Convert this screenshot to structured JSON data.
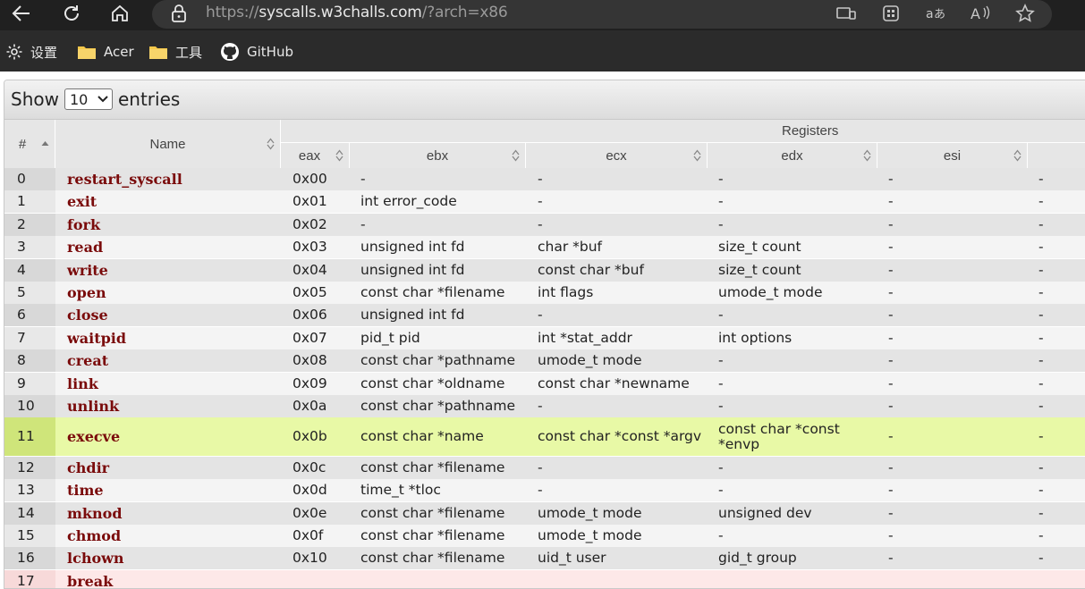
{
  "browser": {
    "url_prefix": "https://",
    "url_host": "syscalls.w3challs.com",
    "url_path": "/?arch=x86",
    "bookmarks": [
      {
        "label": "设置",
        "icon": "gear-icon"
      },
      {
        "label": "Acer",
        "icon": "folder-icon"
      },
      {
        "label": "工具",
        "icon": "folder-icon"
      },
      {
        "label": "GitHub",
        "icon": "github-icon"
      }
    ]
  },
  "table_controls": {
    "show_label": "Show",
    "entries_value": "10",
    "entries_label": "entries"
  },
  "columns": {
    "num": "#",
    "name": "Name",
    "registers": "Registers",
    "eax": "eax",
    "ebx": "ebx",
    "ecx": "ecx",
    "edx": "edx",
    "esi": "esi"
  },
  "colors": {
    "odd_row": "#e4e4e4",
    "even_row": "#f4f4f4",
    "highlight_row": "#e8f9a6",
    "highlight_num": "#cfe57a",
    "name_color": "#7a0b0b",
    "partial_row": "#fde8e8"
  },
  "rows": [
    {
      "num": "0",
      "name": "restart_syscall",
      "eax": "0x00",
      "ebx": "-",
      "ecx": "-",
      "edx": "-",
      "esi": "-",
      "edi": "-"
    },
    {
      "num": "1",
      "name": "exit",
      "eax": "0x01",
      "ebx": "int error_code",
      "ecx": "-",
      "edx": "-",
      "esi": "-",
      "edi": "-"
    },
    {
      "num": "2",
      "name": "fork",
      "eax": "0x02",
      "ebx": "-",
      "ecx": "-",
      "edx": "-",
      "esi": "-",
      "edi": "-"
    },
    {
      "num": "3",
      "name": "read",
      "eax": "0x03",
      "ebx": "unsigned int fd",
      "ecx": "char *buf",
      "edx": "size_t count",
      "esi": "-",
      "edi": "-"
    },
    {
      "num": "4",
      "name": "write",
      "eax": "0x04",
      "ebx": "unsigned int fd",
      "ecx": "const char *buf",
      "edx": "size_t count",
      "esi": "-",
      "edi": "-"
    },
    {
      "num": "5",
      "name": "open",
      "eax": "0x05",
      "ebx": "const char *filename",
      "ecx": "int flags",
      "edx": "umode_t mode",
      "esi": "-",
      "edi": "-"
    },
    {
      "num": "6",
      "name": "close",
      "eax": "0x06",
      "ebx": "unsigned int fd",
      "ecx": "-",
      "edx": "-",
      "esi": "-",
      "edi": "-"
    },
    {
      "num": "7",
      "name": "waitpid",
      "eax": "0x07",
      "ebx": "pid_t pid",
      "ecx": "int *stat_addr",
      "edx": "int options",
      "esi": "-",
      "edi": "-"
    },
    {
      "num": "8",
      "name": "creat",
      "eax": "0x08",
      "ebx": "const char *pathname",
      "ecx": "umode_t mode",
      "edx": "-",
      "esi": "-",
      "edi": "-"
    },
    {
      "num": "9",
      "name": "link",
      "eax": "0x09",
      "ebx": "const char *oldname",
      "ecx": "const char *newname",
      "edx": "-",
      "esi": "-",
      "edi": "-"
    },
    {
      "num": "10",
      "name": "unlink",
      "eax": "0x0a",
      "ebx": "const char *pathname",
      "ecx": "-",
      "edx": "-",
      "esi": "-",
      "edi": "-"
    },
    {
      "num": "11",
      "name": "execve",
      "eax": "0x0b",
      "ebx": "const char *name",
      "ecx": "const char *const *argv",
      "edx": "const char *const *envp",
      "esi": "-",
      "edi": "-"
    },
    {
      "num": "12",
      "name": "chdir",
      "eax": "0x0c",
      "ebx": "const char *filename",
      "ecx": "-",
      "edx": "-",
      "esi": "-",
      "edi": "-"
    },
    {
      "num": "13",
      "name": "time",
      "eax": "0x0d",
      "ebx": "time_t *tloc",
      "ecx": "-",
      "edx": "-",
      "esi": "-",
      "edi": "-"
    },
    {
      "num": "14",
      "name": "mknod",
      "eax": "0x0e",
      "ebx": "const char *filename",
      "ecx": "umode_t mode",
      "edx": "unsigned dev",
      "esi": "-",
      "edi": "-"
    },
    {
      "num": "15",
      "name": "chmod",
      "eax": "0x0f",
      "ebx": "const char *filename",
      "ecx": "umode_t mode",
      "edx": "-",
      "esi": "-",
      "edi": "-"
    },
    {
      "num": "16",
      "name": "lchown",
      "eax": "0x10",
      "ebx": "const char *filename",
      "ecx": "uid_t user",
      "edx": "gid_t group",
      "esi": "-",
      "edi": "-"
    },
    {
      "num": "17",
      "name": "break",
      "eax": "",
      "ebx": "",
      "ecx": "",
      "edx": "",
      "esi": "",
      "edi": ""
    }
  ]
}
